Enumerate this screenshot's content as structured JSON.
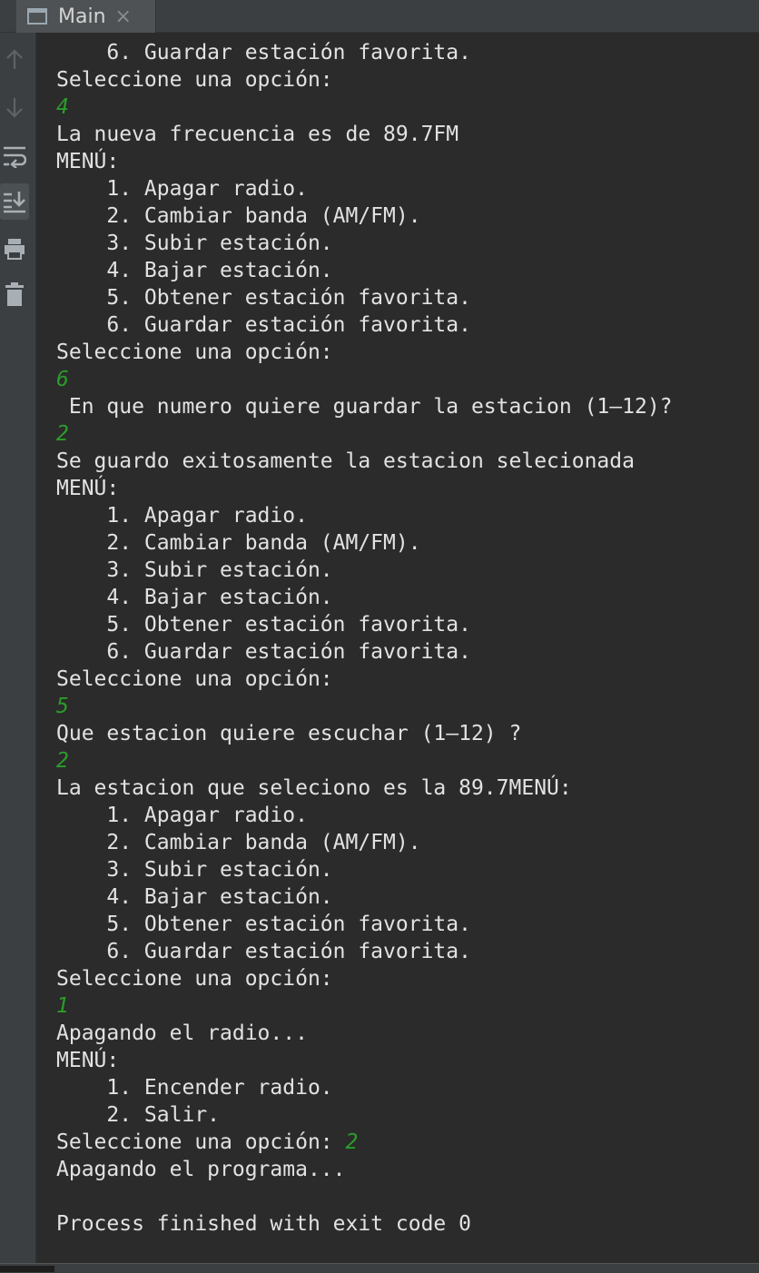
{
  "tab": {
    "title": "Main",
    "close_glyph": "×",
    "icon": "console-window-icon"
  },
  "toolbar": {
    "buttons": [
      {
        "icon": "arrow-up-icon",
        "label": "Up the stack trace"
      },
      {
        "icon": "arrow-down-icon",
        "label": "Down the stack trace"
      },
      {
        "icon": "soft-wrap-icon",
        "label": "Soft-wrap"
      },
      {
        "icon": "scroll-to-end-icon",
        "label": "Scroll to the end",
        "active": true
      },
      {
        "icon": "print-icon",
        "label": "Print"
      },
      {
        "icon": "trash-icon",
        "label": "Clear all"
      }
    ]
  },
  "console": {
    "lines": [
      {
        "type": "out",
        "text": "    6. Guardar estación favorita."
      },
      {
        "type": "out",
        "text": "Seleccione una opción:"
      },
      {
        "type": "in",
        "text": "4"
      },
      {
        "type": "out",
        "text": "La nueva frecuencia es de 89.7FM"
      },
      {
        "type": "out",
        "text": "MENÚ:"
      },
      {
        "type": "out",
        "text": "    1. Apagar radio."
      },
      {
        "type": "out",
        "text": "    2. Cambiar banda (AM/FM)."
      },
      {
        "type": "out",
        "text": "    3. Subir estación."
      },
      {
        "type": "out",
        "text": "    4. Bajar estación."
      },
      {
        "type": "out",
        "text": "    5. Obtener estación favorita."
      },
      {
        "type": "out",
        "text": "    6. Guardar estación favorita."
      },
      {
        "type": "out",
        "text": "Seleccione una opción:"
      },
      {
        "type": "in",
        "text": "6"
      },
      {
        "type": "out",
        "text": " En que numero quiere guardar la estacion (1–12)?"
      },
      {
        "type": "in",
        "text": "2"
      },
      {
        "type": "out",
        "text": "Se guardo exitosamente la estacion selecionada"
      },
      {
        "type": "out",
        "text": "MENÚ:"
      },
      {
        "type": "out",
        "text": "    1. Apagar radio."
      },
      {
        "type": "out",
        "text": "    2. Cambiar banda (AM/FM)."
      },
      {
        "type": "out",
        "text": "    3. Subir estación."
      },
      {
        "type": "out",
        "text": "    4. Bajar estación."
      },
      {
        "type": "out",
        "text": "    5. Obtener estación favorita."
      },
      {
        "type": "out",
        "text": "    6. Guardar estación favorita."
      },
      {
        "type": "out",
        "text": "Seleccione una opción:"
      },
      {
        "type": "in",
        "text": "5"
      },
      {
        "type": "out",
        "text": "Que estacion quiere escuchar (1–12) ?"
      },
      {
        "type": "in",
        "text": "2"
      },
      {
        "type": "out",
        "text": "La estacion que seleciono es la 89.7MENÚ:"
      },
      {
        "type": "out",
        "text": "    1. Apagar radio."
      },
      {
        "type": "out",
        "text": "    2. Cambiar banda (AM/FM)."
      },
      {
        "type": "out",
        "text": "    3. Subir estación."
      },
      {
        "type": "out",
        "text": "    4. Bajar estación."
      },
      {
        "type": "out",
        "text": "    5. Obtener estación favorita."
      },
      {
        "type": "out",
        "text": "    6. Guardar estación favorita."
      },
      {
        "type": "out",
        "text": "Seleccione una opción:"
      },
      {
        "type": "in",
        "text": "1"
      },
      {
        "type": "out",
        "text": "Apagando el radio..."
      },
      {
        "type": "out",
        "text": "MENÚ:"
      },
      {
        "type": "out",
        "text": "    1. Encender radio."
      },
      {
        "type": "out",
        "text": "    2. Salir."
      },
      {
        "type": "mixed",
        "text": "Seleccione una opción: ",
        "input": "2"
      },
      {
        "type": "out",
        "text": "Apagando el programa..."
      },
      {
        "type": "out",
        "text": ""
      },
      {
        "type": "out",
        "text": "Process finished with exit code 0"
      }
    ]
  },
  "colors": {
    "background": "#2b2b2b",
    "panel": "#3c3f41",
    "output_text": "#e2e2e2",
    "input_text": "#2a9d2a",
    "icon": "#8a8d8f"
  }
}
